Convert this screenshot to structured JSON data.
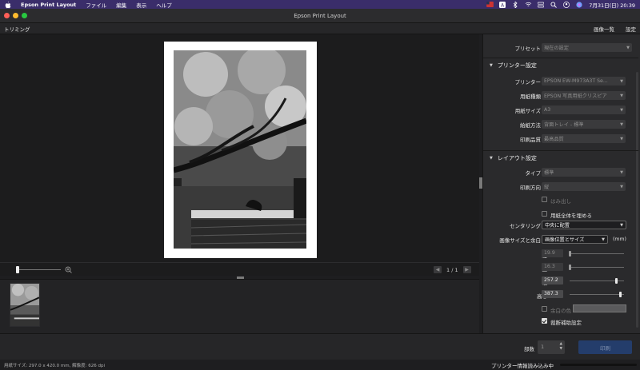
{
  "menubar": {
    "app_name": "Epson Print Layout",
    "items": [
      "ファイル",
      "編集",
      "表示",
      "ヘルプ"
    ],
    "datetime": "7月31日(日)  20:39"
  },
  "window": {
    "title": "Epson Print Layout"
  },
  "toolbar": {
    "left_label": "トリミング",
    "image_list_label": "画像一覧",
    "settings_label": "設定"
  },
  "preview": {
    "page_indicator": "1 / 1"
  },
  "panel": {
    "preset": {
      "label": "プリセット",
      "value": "現在の設定"
    },
    "printer_section": {
      "title": "プリンター設定",
      "rows": [
        {
          "label": "プリンター",
          "value": "EPSON EW-M973A3T Se..."
        },
        {
          "label": "用紙種類",
          "value": "EPSON 写真用紙クリスピア"
        },
        {
          "label": "用紙サイズ",
          "value": "A3"
        },
        {
          "label": "給紙方法",
          "value": "背面トレイ - 標準"
        },
        {
          "label": "印刷品質",
          "value": "最高品質"
        }
      ]
    },
    "layout_section": {
      "title": "レイアウト設定",
      "type": {
        "label": "タイプ",
        "value": "標準"
      },
      "orientation": {
        "label": "印刷方向",
        "value": "縦"
      },
      "borderless_label": "はみ出し",
      "fill_paper_label": "用紙全体を埋める",
      "centering": {
        "label": "センタリング",
        "value": "中央に配置"
      },
      "image_size": {
        "label": "画像サイズと余白",
        "value": "画像位置とサイズ",
        "unit": "(mm)"
      },
      "left": {
        "label": "左",
        "value": "19.9"
      },
      "top": {
        "label": "上",
        "value": "16.3"
      },
      "width": {
        "label": "幅",
        "value": "257.2"
      },
      "height": {
        "label": "高さ",
        "value": "387.3"
      },
      "margin_color_label": "余白の色",
      "crop_marks_label": "裁断補助設定",
      "crop_marks_checked": true
    }
  },
  "bottombar": {
    "copies_label": "部数",
    "copies_value": "1",
    "print_label": "印刷"
  },
  "statusbar": {
    "left_text": "用紙サイズ: 297.0 x 420.0 mm,  解像度: 626 dpi",
    "right_text": "プリンター情報読み込み中"
  },
  "colors": {
    "menubar": "#3a2d6a",
    "print_button": "#243d6b",
    "panel_bg": "#2a2a2c"
  }
}
